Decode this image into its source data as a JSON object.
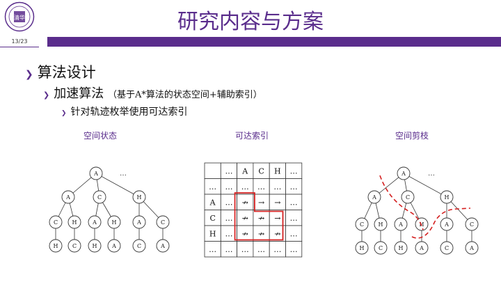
{
  "slide": {
    "title": "研究内容与方案",
    "page_number": "13/23",
    "accent_color": "#5a2d8c",
    "logo": {
      "icon": "university-seal-icon",
      "text": "清华"
    }
  },
  "bullets": {
    "level1": "算法设计",
    "level2": "加速算法",
    "level2_note": "（基于A*算法的状态空间+辅助索引）",
    "level3": "针对轨迹枚举使用可达索引"
  },
  "captions": {
    "state_space": "空间状态",
    "reach_index": "可达索引",
    "pruning": "空间剪枝"
  },
  "tree": {
    "root": "A",
    "ellipsis": "…",
    "level1": [
      "A",
      "C",
      "H"
    ],
    "level2": [
      "C",
      "H",
      "A",
      "H",
      "A",
      "C"
    ],
    "level3": [
      "H",
      "C",
      "H",
      "A",
      "C",
      "A"
    ]
  },
  "grid": {
    "rows": [
      [
        "",
        "…",
        "A",
        "C",
        "H",
        "…"
      ],
      [
        "…",
        "…",
        "…",
        "…",
        "…",
        "…"
      ],
      [
        "A",
        "…",
        "↛",
        "→",
        "→",
        "…"
      ],
      [
        "C",
        "…",
        "↛",
        "↛",
        "→",
        "…"
      ],
      [
        "H",
        "…",
        "↛",
        "↛",
        "↛",
        "…"
      ],
      [
        "…",
        "…",
        "…",
        "…",
        "…",
        "…"
      ]
    ],
    "highlight_color": "#d42020"
  }
}
